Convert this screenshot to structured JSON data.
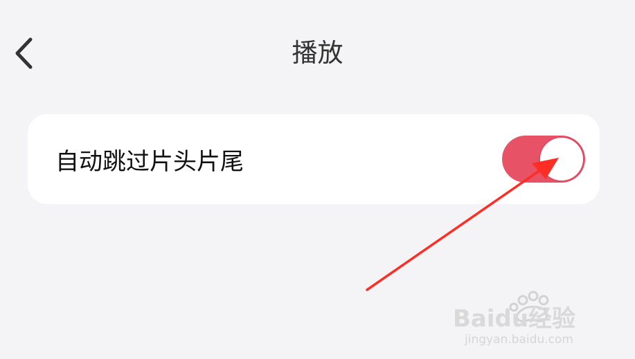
{
  "header": {
    "title": "播放",
    "back_icon": "chevron-left-icon"
  },
  "settings": {
    "item": {
      "label": "自动跳过片头片尾",
      "toggle_on": true
    }
  },
  "colors": {
    "background": "#f4f4f7",
    "card": "#ffffff",
    "toggle_on": "#e85267",
    "arrow": "#ff2e24"
  },
  "watermark": {
    "brand": "Baidu经验",
    "url": "jingyan.baidu.com"
  }
}
